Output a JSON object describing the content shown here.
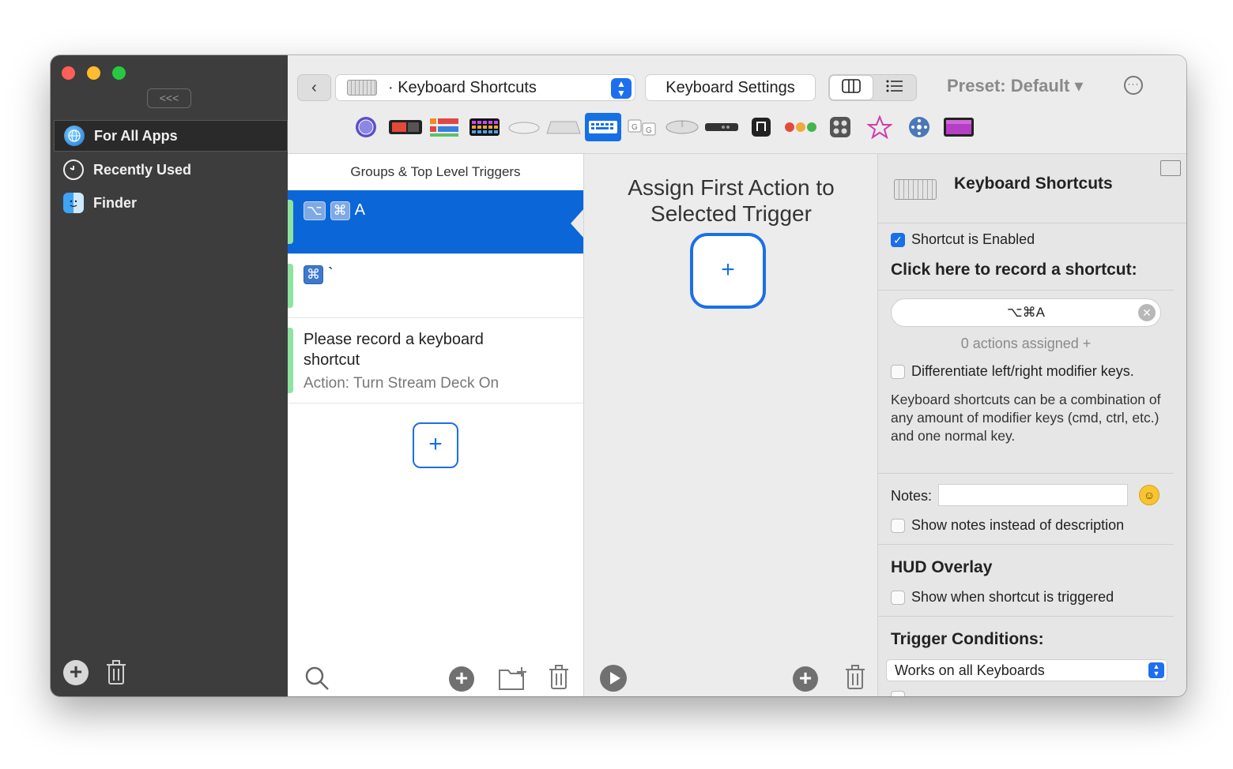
{
  "sidebar": {
    "collapse_label": "<<<",
    "items": [
      {
        "label": "For All Apps",
        "icon": "globe-icon",
        "active": true
      },
      {
        "label": "Recently Used",
        "icon": "clock-icon",
        "active": false
      },
      {
        "label": "Finder",
        "icon": "finder-icon",
        "active": false
      }
    ]
  },
  "toolbar": {
    "back_label": "‹",
    "trigger_type": "· Keyboard Shortcuts",
    "settings_label": "Keyboard Settings",
    "preset_label": "Preset: Default ▾",
    "view_modes": [
      "columns",
      "list"
    ],
    "categories": [
      "trackpad-icon",
      "touchbar-icon",
      "stream-deck-icon",
      "keyboard-grid-icon",
      "magic-mouse-icon",
      "apple-keyboard-icon",
      "keyboard-icon",
      "key-sequences-icon",
      "normal-mouse-icon",
      "siri-remote-icon",
      "drawings-icon",
      "floating-menu-icon",
      "other-icon",
      "leap-icon",
      "named-triggers-icon",
      "automations-icon"
    ],
    "selected_category": "keyboard-icon"
  },
  "list": {
    "header": "Groups & Top Level Triggers",
    "triggers": [
      {
        "keys": [
          "⌥",
          "⌘"
        ],
        "key_char": "A",
        "title": "",
        "subtitle": "",
        "selected": true
      },
      {
        "keys": [
          "⌘"
        ],
        "key_char": "`",
        "title": "",
        "subtitle": "",
        "selected": false
      },
      {
        "keys": [],
        "key_char": "",
        "title": "Please record a keyboard shortcut",
        "subtitle": "Action: Turn Stream Deck On",
        "selected": false
      }
    ],
    "add_label": "+"
  },
  "actions": {
    "title_line1": "Assign First Action to",
    "title_line2": "Selected Trigger",
    "add_label": "+"
  },
  "inspector": {
    "title": "Keyboard Shortcuts",
    "enabled_label": "Shortcut is Enabled",
    "enabled": true,
    "record_heading": "Click here to record a shortcut:",
    "shortcut_value": "⌥⌘A",
    "clear_label": "✕",
    "assigned_text": "0 actions assigned +",
    "differentiate_label": "Differentiate left/right modifier keys.",
    "description": "Keyboard shortcuts can be a combination of any amount of modifier keys (cmd, ctrl, etc.) and one normal key.",
    "notes_label": "Notes:",
    "notes_value": "",
    "show_notes_label": "Show notes instead of description",
    "hud_heading": "HUD Overlay",
    "hud_label": "Show when shortcut is triggered",
    "conditions_heading": "Trigger Conditions:",
    "conditions_value": "Works on all Keyboards"
  }
}
